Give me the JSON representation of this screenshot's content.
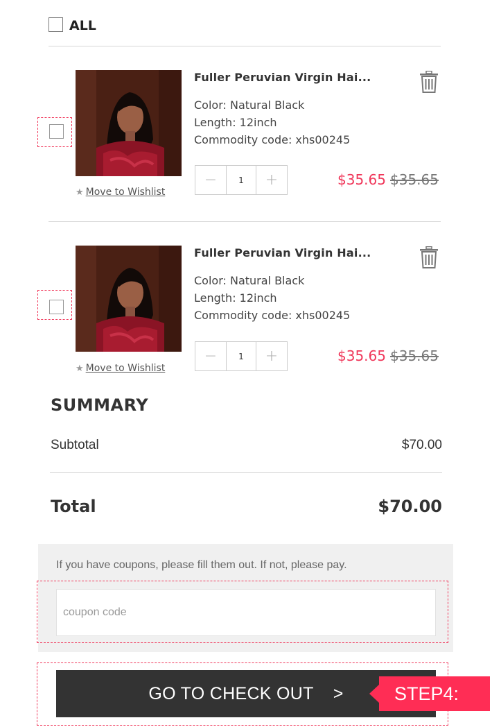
{
  "select_all": {
    "label": "ALL"
  },
  "items": [
    {
      "title": "Fuller Peruvian Virgin Hai...",
      "color": "Color: Natural Black",
      "length": "Length: 12inch",
      "code": "Commodity code: xhs00245",
      "quantity": "1",
      "price": "$35.65",
      "old_price": "$35.65",
      "wishlist": "Move to Wishlist"
    },
    {
      "title": "Fuller Peruvian Virgin Hai...",
      "color": "Color: Natural Black",
      "length": "Length: 12inch",
      "code": "Commodity code: xhs00245",
      "quantity": "1",
      "price": "$35.65",
      "old_price": "$35.65",
      "wishlist": "Move to Wishlist"
    }
  ],
  "summary": {
    "title": "SUMMARY",
    "subtotal_label": "Subtotal",
    "subtotal_value": "$70.00",
    "total_label": "Total",
    "total_value": "$70.00"
  },
  "coupon": {
    "note": "If you have coupons, please fill them out. If not, please pay.",
    "placeholder": "coupon code"
  },
  "checkout": {
    "label": "GO TO CHECK OUT",
    "arrow": ">",
    "step_label": "STEP4:"
  },
  "colors": {
    "accent": "#f0375a",
    "button": "#333333",
    "coupon_bg": "#f0f0f0"
  },
  "icons": [
    "trash-icon",
    "star-icon",
    "minus-icon",
    "plus-icon"
  ]
}
